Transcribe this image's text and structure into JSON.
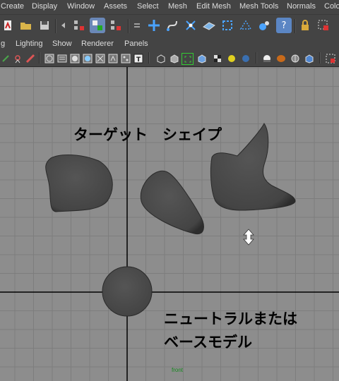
{
  "menu": {
    "create": "Create",
    "display": "Display",
    "window": "Window",
    "assets": "Assets",
    "select": "Select",
    "mesh": "Mesh",
    "edit_mesh": "Edit Mesh",
    "mesh_tools": "Mesh Tools",
    "normals": "Normals",
    "color": "Colo"
  },
  "panel_menu": {
    "shading_partial": "g",
    "lighting": "Lighting",
    "show": "Show",
    "renderer": "Renderer",
    "panels": "Panels"
  },
  "viewport": {
    "camera_label": "front",
    "target_shapes_label": "ターゲット　シェイプ",
    "base_model_line1": "ニュートラルまたは",
    "base_model_line2": "ベースモデル"
  },
  "colors": {
    "viewport_bg": "#8d8d8d",
    "grid_line": "#7a7a7a",
    "axis_line": "#000000",
    "mesh_fill": "#4a4a4a",
    "camera_label": "#15881d",
    "accent_blue": "#5b86c4"
  },
  "icons": {
    "toolbar": [
      "new-scene-icon",
      "open-scene-icon",
      "save-scene-icon",
      "select-hierarchy-icon",
      "select-object-icon",
      "select-component-icon",
      "snap-grid-icon",
      "snap-curve-icon",
      "snap-point-icon",
      "snap-plane-icon",
      "make-live-icon",
      "snap-mesh-icon",
      "symmetry-icon",
      "help-icon",
      "lock-icon",
      "select-region-icon"
    ],
    "panel": [
      "camera-attributes-icon",
      "bookmark-icon",
      "image-plane-icon",
      "wireframe-icon",
      "smooth-shade-icon",
      "xray-icon",
      "grid-toggle-icon",
      "texture-icon",
      "film-gate-icon",
      "isolate-select-icon",
      "resolution-gate-icon",
      "gate-mask-icon",
      "field-chart-icon",
      "safe-action-icon",
      "lights-icon",
      "shadows-icon",
      "ambient-occlusion-icon",
      "material-icon",
      "shading-ball-icon",
      "smooth-mesh-icon"
    ]
  }
}
